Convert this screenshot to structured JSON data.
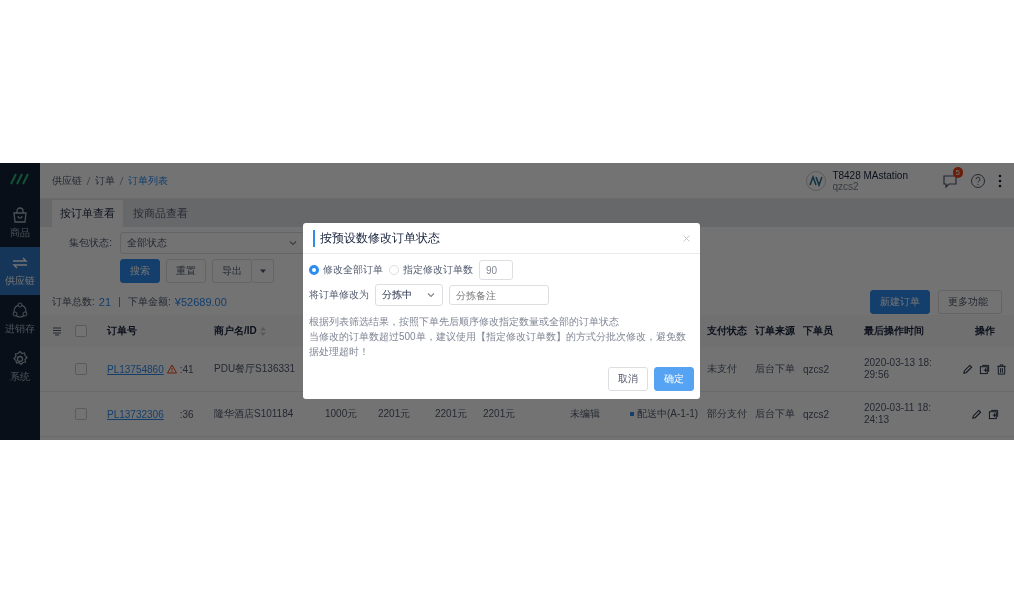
{
  "sidebar": {
    "items": [
      {
        "label": "商品",
        "kind": "bag",
        "selected": false
      },
      {
        "label": "供应链",
        "kind": "swap",
        "selected": true
      },
      {
        "label": "进销存",
        "kind": "nodes",
        "selected": false
      },
      {
        "label": "系统",
        "kind": "gear",
        "selected": false
      }
    ]
  },
  "breadcrumb": [
    {
      "label": "供应链",
      "current": false
    },
    {
      "label": "订单",
      "current": false
    },
    {
      "label": "订单列表",
      "current": true
    }
  ],
  "account": {
    "name": "T8428 MAstation",
    "user": "qzcs2",
    "unread": "5"
  },
  "view_tabs": [
    {
      "label": "按订单查看",
      "selected": true
    },
    {
      "label": "按商品查看",
      "selected": false
    }
  ],
  "filter": {
    "label": "集包状态:",
    "value": "全部状态"
  },
  "filter_buttons": [
    {
      "label": "搜索",
      "kind": "primary"
    },
    {
      "label": "重置",
      "kind": "default"
    },
    {
      "label": "导出",
      "kind": "split"
    }
  ],
  "summary": {
    "count_label": "订单总数:",
    "count": "21",
    "amount_label": "下单金额:",
    "amount": "¥52689.00"
  },
  "actions": [
    {
      "label": "新建订单",
      "kind": "primary"
    },
    {
      "label": "更多功能",
      "kind": "dropdown"
    }
  ],
  "table": {
    "header_checked": false,
    "columns": {
      "order_no": "订单号",
      "merchant": "商户名/ID",
      "payment_status": "支付状态",
      "source": "订单来源",
      "operator": "下单员",
      "last_modified": "最后操作时间",
      "actions": "操作"
    },
    "rows": [
      {
        "checked": false,
        "order_no": "PL13754860",
        "warning": true,
        "time": ":41",
        "merchant": "PDU餐厅S136331",
        "payment_status": "未支付",
        "source": "后台下单",
        "operator": "qzcs2",
        "last_modified": "2020-03-13 18:29:56",
        "deletable": true
      },
      {
        "checked": false,
        "order_no": "PL13732306",
        "warning": false,
        "time": ":36",
        "merchant": "隆华酒店S101184",
        "column_5": "1000元",
        "column_6": "2201元",
        "column_7": "2201元",
        "column_8": "2201元",
        "column_9": "未编辑",
        "column_10": "配送中(A-1-1)",
        "payment_status": "部分支付",
        "source": "后台下单",
        "operator": "qzcs2",
        "last_modified": "2020-03-11 18:24:13",
        "deletable": false
      }
    ]
  },
  "dialog": {
    "title": "按预设数修改订单状态",
    "scope_options": [
      {
        "label": "修改全部订单",
        "selected": true
      },
      {
        "label": "指定修改订单数",
        "selected": false
      }
    ],
    "count_value": "90",
    "target_label": "将订单修改为",
    "target_value": "分拣中",
    "note_placeholder": "分拣备注",
    "notes": [
      "根据列表筛选结果，按照下单先后顺序修改指定数量或全部的订单状态",
      "当修改的订单数超过500单，建议使用【指定修改订单数】的方式分批次修改，避免数据处理超时！"
    ],
    "buttons": [
      {
        "label": "取消",
        "kind": "default"
      },
      {
        "label": "确定",
        "kind": "primary"
      }
    ]
  }
}
